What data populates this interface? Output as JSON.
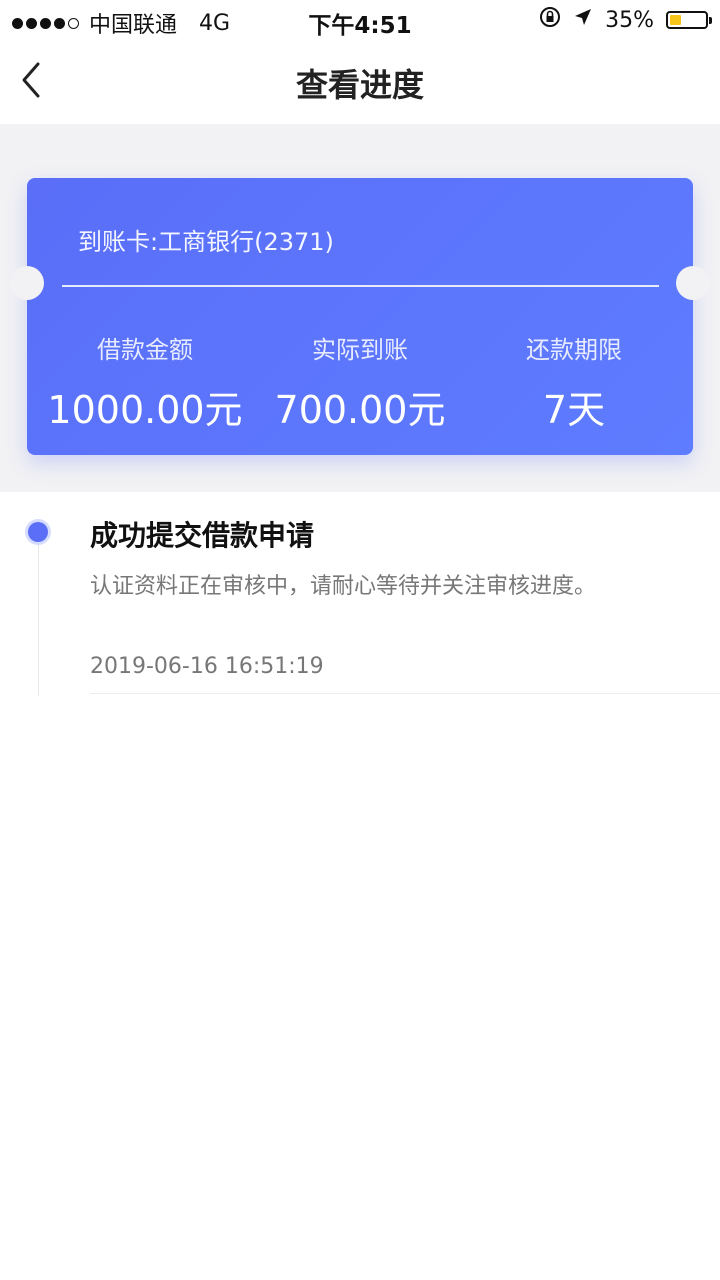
{
  "status_bar": {
    "carrier": "中国联通",
    "network": "4G",
    "time": "下午4:51",
    "battery_percent": "35%",
    "battery_level": 0.35,
    "signal_bars": 4,
    "signal_total": 5
  },
  "nav": {
    "title": "查看进度",
    "back_icon": "chevron-left-icon"
  },
  "card": {
    "account_label": "到账卡:工商银行(2371)",
    "stats": [
      {
        "label": "借款金额",
        "value": "1000.00元"
      },
      {
        "label": "实际到账",
        "value": "700.00元"
      },
      {
        "label": "还款期限",
        "value": "7天"
      }
    ],
    "gradient_colors": [
      "#5a6ef8",
      "#5e7cff"
    ]
  },
  "timeline": {
    "items": [
      {
        "title": "成功提交借款申请",
        "description": "认证资料正在审核中，请耐心等待并关注审核进度。",
        "timestamp": "2019-06-16 16:51:19"
      }
    ],
    "dot_color": "#5a6ef8"
  }
}
